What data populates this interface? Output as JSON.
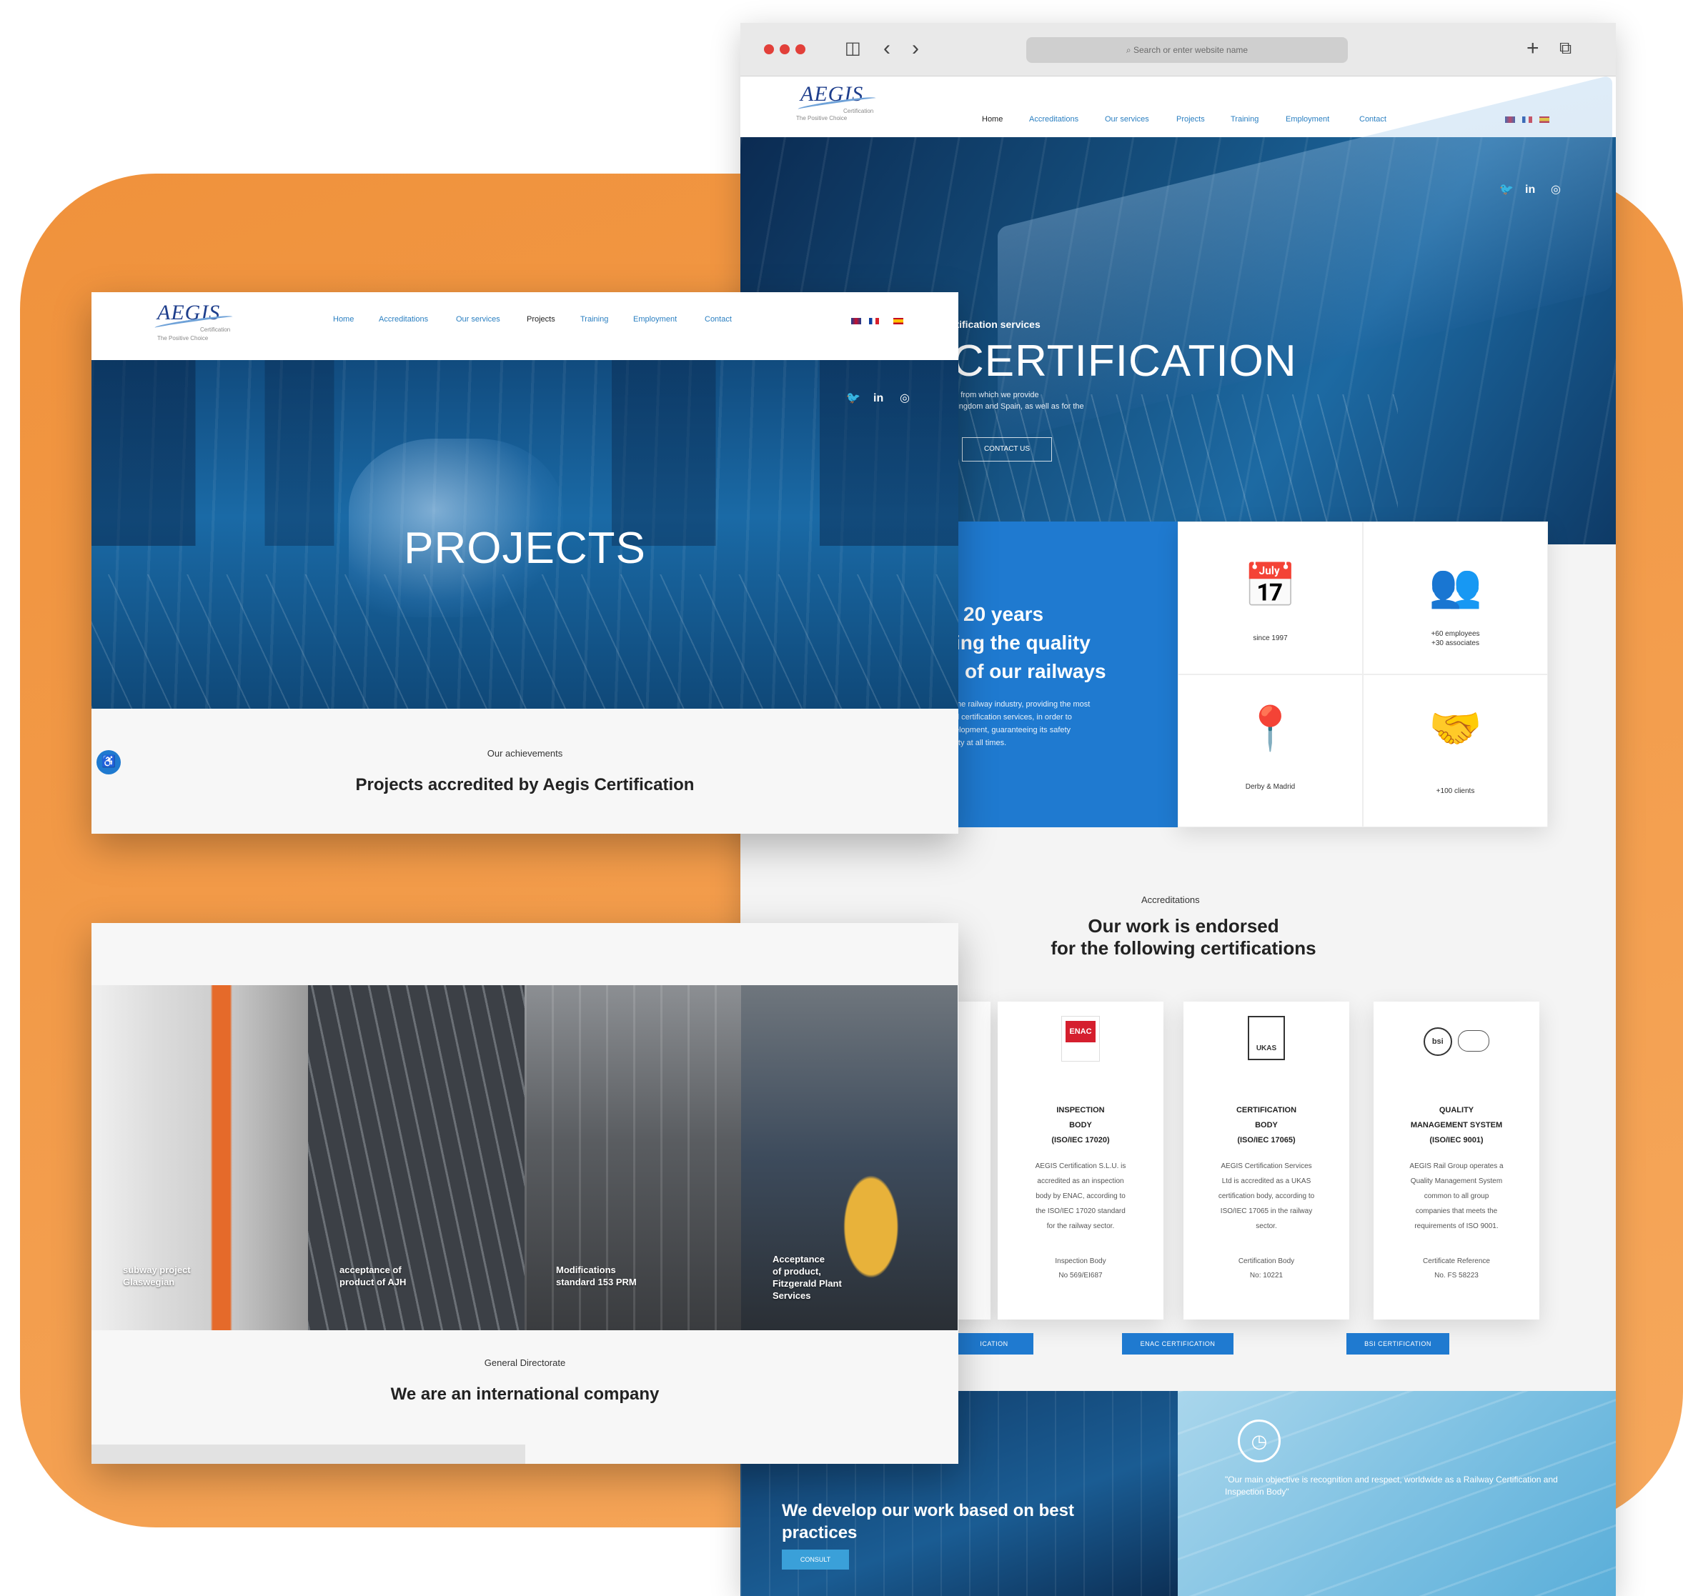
{
  "colors": {
    "orange": "#f29a48",
    "brand_blue": "#1f7ad0",
    "link_blue": "#2a7fc1",
    "logo_navy": "#1e3e8c"
  },
  "browser": {
    "address_placeholder": "Search or enter website name",
    "icons": [
      "sidebar-icon",
      "back-icon",
      "forward-icon",
      "new-tab-icon",
      "tabs-icon"
    ]
  },
  "site": {
    "logo": "AEGIS",
    "logo_small": "Certification",
    "tagline": "The Positive Choice",
    "nav": [
      "Home",
      "Accreditations",
      "Our services",
      "Projects",
      "Training",
      "Employment",
      "Contact"
    ],
    "languages": [
      "English",
      "French",
      "Spanish"
    ]
  },
  "home": {
    "hero_sub": "rtification services",
    "hero_title": "CERTIFICATION",
    "hero_line1": "d, from which we provide",
    "hero_line2": "Kingdom and Spain, as well as for the",
    "contact_button": "CONTACT US",
    "panel_title_1": "20 years",
    "panel_title_2": "ing the quality",
    "panel_title_3": "of our railways",
    "panel_line1": "the railway industry, providing the most",
    "panel_line2": "d certification services, in order to",
    "panel_line3": "elopment, guaranteeing its safety",
    "panel_line4": "lity at all times.",
    "stats": [
      {
        "icon": "calendar-icon",
        "label": "since 1997"
      },
      {
        "icon": "people-icon",
        "label": "+60 employees\n+30 associates"
      },
      {
        "icon": "location-pins-icon",
        "label": "Derby & Madrid"
      },
      {
        "icon": "handshake-icon",
        "label": "+100 clients"
      }
    ],
    "accred_small": "Accreditations",
    "accred_title_1": "Our work is endorsed",
    "accred_title_2": "for the following certifications",
    "certs": [
      {
        "logo": "ENAC",
        "title": "INSPECTION\nBODY\n(ISO/IEC 17020)",
        "body": "AEGIS Certification S.L.U. is\naccredited as an inspection\nbody by ENAC, according to\nthe ISO/IEC 17020 standard\nfor the railway sector.",
        "ref": "Inspection Body\nNo 569/EI687"
      },
      {
        "logo": "UKAS",
        "title": "CERTIFICATION\nBODY\n(ISO/IEC 17065)",
        "body": "AEGIS Certification Services\nLtd is accredited as a UKAS\ncertification body, according to\nISO/IEC 17065 in the railway\nsector.",
        "ref": "Certification Body\nNo: 10221"
      },
      {
        "logo": "bsi",
        "title": "QUALITY\nMANAGEMENT SYSTEM\n(ISO/IEC 9001)",
        "body": "AEGIS Rail Group operates a\nQuality Management System\ncommon to all group\ncompanies that meets the\nrequirements of ISO 9001.",
        "ref": "Certificate Reference\nNo. FS 58223"
      }
    ],
    "cert_buttons": [
      "ICATION",
      "ENAC CERTIFICATION",
      "BSI CERTIFICATION"
    ],
    "best_practices": "We develop our work based on best practices",
    "consult_button": "CONSULT",
    "quote": "\"Our main objective is recognition and respect, worldwide as a Railway Certification and Inspection Body\""
  },
  "projects_page": {
    "title": "PROJECTS",
    "small": "Our achievements",
    "subtitle": "Projects accredited by Aegis Certification"
  },
  "gallery": {
    "tiles": [
      "subway project\nGlaswegian",
      "acceptance of\nproduct of AJH",
      "Modifications\nstandard 153 PRM",
      "Acceptance\nof product,\nFitzgerald Plant\nServices"
    ],
    "small": "General Directorate",
    "title": "We are an international company"
  }
}
